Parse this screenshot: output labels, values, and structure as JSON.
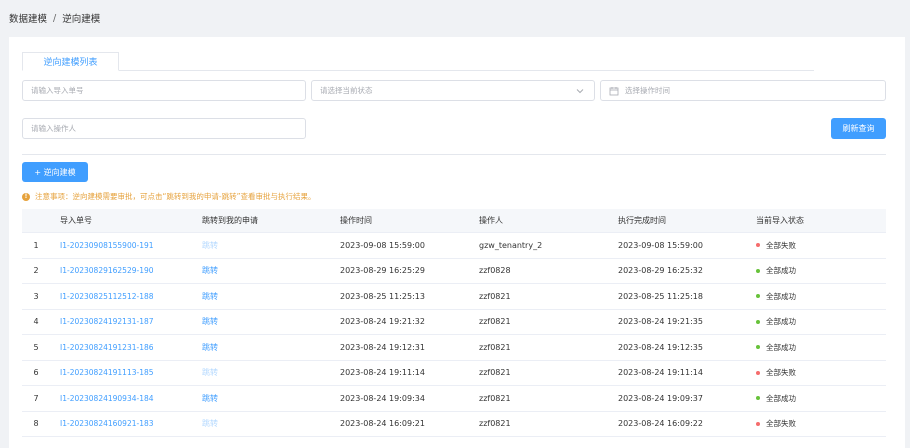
{
  "breadcrumb": {
    "parent": "数据建模",
    "separator": "/",
    "current": "逆向建模"
  },
  "tabs": [
    {
      "label": "逆向建模列表"
    }
  ],
  "filters": {
    "import_no_placeholder": "请输入导入单号",
    "status_placeholder": "请选择当前状态",
    "time_placeholder": "选择操作时间",
    "operator_placeholder": "请输入操作人"
  },
  "buttons": {
    "refresh": "刷新查询",
    "add": "+ 逆向建模"
  },
  "notice": {
    "icon": "!",
    "text": "注意事项：逆向建模需要审批，可点击“跳转到我的申请-跳转”查看审批与执行结果。"
  },
  "table": {
    "columns": [
      "导入单号",
      "跳转到我的申请",
      "操作时间",
      "操作人",
      "执行完成时间",
      "当前导入状态"
    ],
    "rows": [
      {
        "idx": "1",
        "no": "I1-20230908155900-191",
        "jump": "跳转",
        "jump_enabled": false,
        "time": "2023-09-08 15:59:00",
        "operator": "gzw_tenantry_2",
        "done": "2023-09-08 15:59:00",
        "status": "全部失败",
        "status_color": "#f56c6c"
      },
      {
        "idx": "2",
        "no": "I1-20230829162529-190",
        "jump": "跳转",
        "jump_enabled": true,
        "time": "2023-08-29 16:25:29",
        "operator": "zzf0828",
        "done": "2023-08-29 16:25:32",
        "status": "全部成功",
        "status_color": "#67c23a"
      },
      {
        "idx": "3",
        "no": "I1-20230825112512-188",
        "jump": "跳转",
        "jump_enabled": true,
        "time": "2023-08-25 11:25:13",
        "operator": "zzf0821",
        "done": "2023-08-25 11:25:18",
        "status": "全部成功",
        "status_color": "#67c23a"
      },
      {
        "idx": "4",
        "no": "I1-20230824192131-187",
        "jump": "跳转",
        "jump_enabled": true,
        "time": "2023-08-24 19:21:32",
        "operator": "zzf0821",
        "done": "2023-08-24 19:21:35",
        "status": "全部成功",
        "status_color": "#67c23a"
      },
      {
        "idx": "5",
        "no": "I1-20230824191231-186",
        "jump": "跳转",
        "jump_enabled": true,
        "time": "2023-08-24 19:12:31",
        "operator": "zzf0821",
        "done": "2023-08-24 19:12:35",
        "status": "全部成功",
        "status_color": "#67c23a"
      },
      {
        "idx": "6",
        "no": "I1-20230824191113-185",
        "jump": "跳转",
        "jump_enabled": false,
        "time": "2023-08-24 19:11:14",
        "operator": "zzf0821",
        "done": "2023-08-24 19:11:14",
        "status": "全部失败",
        "status_color": "#f56c6c"
      },
      {
        "idx": "7",
        "no": "I1-20230824190934-184",
        "jump": "跳转",
        "jump_enabled": true,
        "time": "2023-08-24 19:09:34",
        "operator": "zzf0821",
        "done": "2023-08-24 19:09:37",
        "status": "全部成功",
        "status_color": "#67c23a"
      },
      {
        "idx": "8",
        "no": "I1-20230824160921-183",
        "jump": "跳转",
        "jump_enabled": false,
        "time": "2023-08-24 16:09:21",
        "operator": "zzf0821",
        "done": "2023-08-24 16:09:22",
        "status": "全部失败",
        "status_color": "#f56c6c"
      }
    ]
  },
  "colors": {
    "accent": "#409eff",
    "warning": "#e6a23c",
    "success": "#67c23a",
    "danger": "#f56c6c"
  },
  "icons": {
    "dropdown": "chevron-down-icon",
    "date": "calendar-icon",
    "notice": "warning-circle-icon"
  }
}
